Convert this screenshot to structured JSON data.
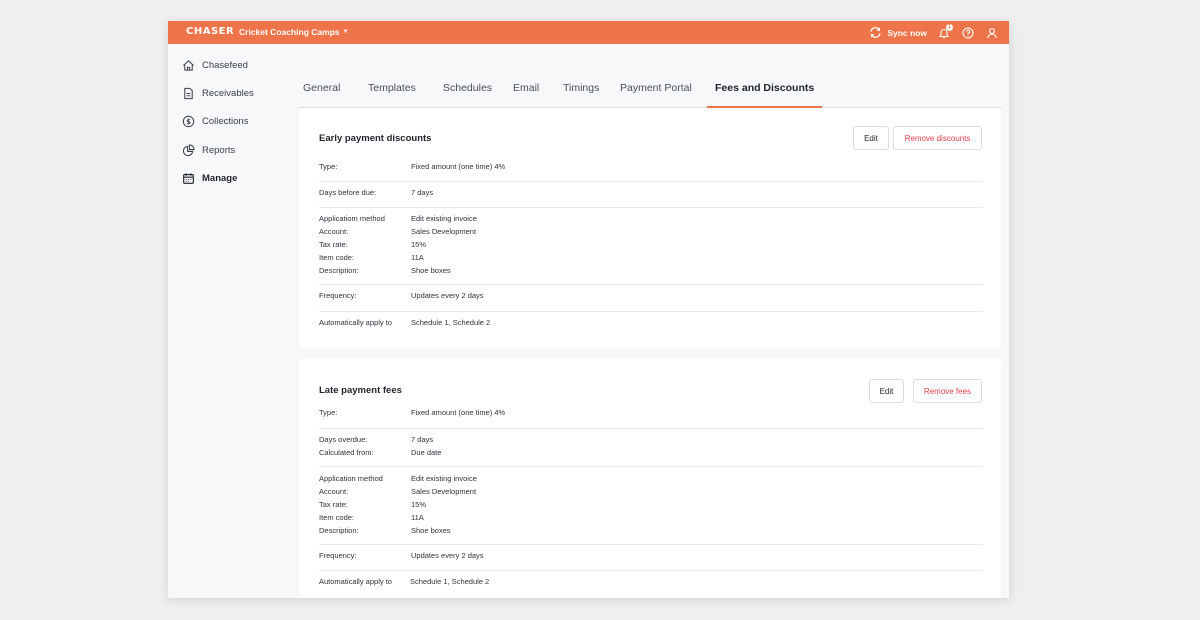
{
  "topbar": {
    "logo": "CHASER",
    "org": "Cricket Coaching Camps",
    "sync_label": "Sync now",
    "notification_count": "1",
    "accent": "#f0744a"
  },
  "sidebar": {
    "items": [
      {
        "label": "Chasefeed",
        "icon": "home-icon"
      },
      {
        "label": "Receivables",
        "icon": "document-icon"
      },
      {
        "label": "Collections",
        "icon": "dollar-circle-icon"
      },
      {
        "label": "Reports",
        "icon": "pie-chart-icon"
      },
      {
        "label": "Manage",
        "icon": "calendar-icon",
        "active": true
      }
    ]
  },
  "tabs": [
    {
      "label": "General"
    },
    {
      "label": "Templates"
    },
    {
      "label": "Schedules"
    },
    {
      "label": "Email"
    },
    {
      "label": "Timings"
    },
    {
      "label": "Payment Portal"
    },
    {
      "label": "Fees and Discounts",
      "active": true
    }
  ],
  "early": {
    "title": "Early payment discounts",
    "edit_label": "Edit",
    "remove_label": "Remove discounts",
    "type_label": "Type:",
    "type_value": "Fixed amount (one time) 4%",
    "days_label": "Days before due:",
    "days_value": "7 days",
    "method_label": "Applicatiom method",
    "method_value": "Edit existing invoice",
    "account_label": "Account:",
    "account_value": "Sales Development",
    "tax_label": "Tax rate:",
    "tax_value": "15%",
    "item_label": "Item code:",
    "item_value": "11A",
    "desc_label": "Description:",
    "desc_value": "Shoe boxes",
    "freq_label": "Frequency:",
    "freq_value": "Updates every 2 days",
    "auto_label": "Automatically apply to",
    "auto_value": "Schedule 1, Schedule 2"
  },
  "late": {
    "title": "Late payment fees",
    "edit_label": "Edit",
    "remove_label": "Remove fees",
    "type_label": "Type:",
    "type_value": "Fixed amount (one time) 4%",
    "overdue_label": "Days overdue:",
    "overdue_value": "7 days",
    "calc_label": "Calculated from:",
    "calc_value": "Due date",
    "method_label": "Application method",
    "method_value": "Edit existing invoice",
    "account_label": "Account:",
    "account_value": "Sales Development",
    "tax_label": "Tax rate:",
    "tax_value": "15%",
    "item_label": "Item code:",
    "item_value": "11A",
    "desc_label": "Description:",
    "desc_value": "Shoe boxes",
    "freq_label": "Frequency:",
    "freq_value": "Updates every 2 days",
    "auto_label": "Automatically apply to",
    "auto_value": "Schedule 1, Schedule 2"
  }
}
